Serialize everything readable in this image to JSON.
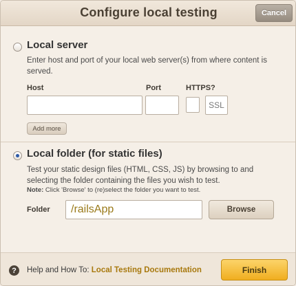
{
  "dialog": {
    "title": "Configure local testing",
    "cancel_label": "Cancel"
  },
  "local_server": {
    "heading": "Local server",
    "selected": false,
    "description": "Enter host and port of your local web server(s) from where content is served.",
    "host_label": "Host",
    "port_label": "Port",
    "https_label": "HTTPS?",
    "host_value": "",
    "port_value": "",
    "ssl_label": "SSL",
    "add_more_label": "Add more"
  },
  "local_folder": {
    "heading": "Local folder (for static files)",
    "selected": true,
    "description": "Test your static design files (HTML, CSS, JS) by browsing to and selecting the folder containing the files you wish to test.",
    "note_prefix": "Note:",
    "note_text": "Click 'Browse' to (re)select the folder you want to test.",
    "folder_label": "Folder",
    "folder_value": "/railsApp",
    "browse_label": "Browse"
  },
  "footer": {
    "help_icon_glyph": "?",
    "help_prefix": "Help and How To:",
    "help_link": "Local Testing Documentation",
    "finish_label": "Finish"
  },
  "colors": {
    "accent": "#f0ae1f",
    "link": "#a8790e",
    "radio_selected": "#2d5aa8"
  }
}
